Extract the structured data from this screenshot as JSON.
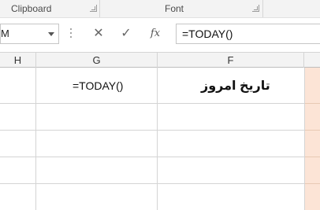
{
  "ribbon": {
    "groups": [
      {
        "label": "Clipboard"
      },
      {
        "label": "Font"
      }
    ]
  },
  "formula_bar": {
    "namebox_value": "M",
    "cancel_symbol": "✕",
    "enter_symbol": "✓",
    "fx_label": "fx",
    "formula": "=TODAY()"
  },
  "columns": [
    {
      "label": "H"
    },
    {
      "label": "G"
    },
    {
      "label": "F"
    }
  ],
  "cells": {
    "G1": "=TODAY()",
    "F1": "تاریخ امروز"
  },
  "colors": {
    "peach_fill": "#fce4d6",
    "grid_line": "#d4d4d4"
  }
}
